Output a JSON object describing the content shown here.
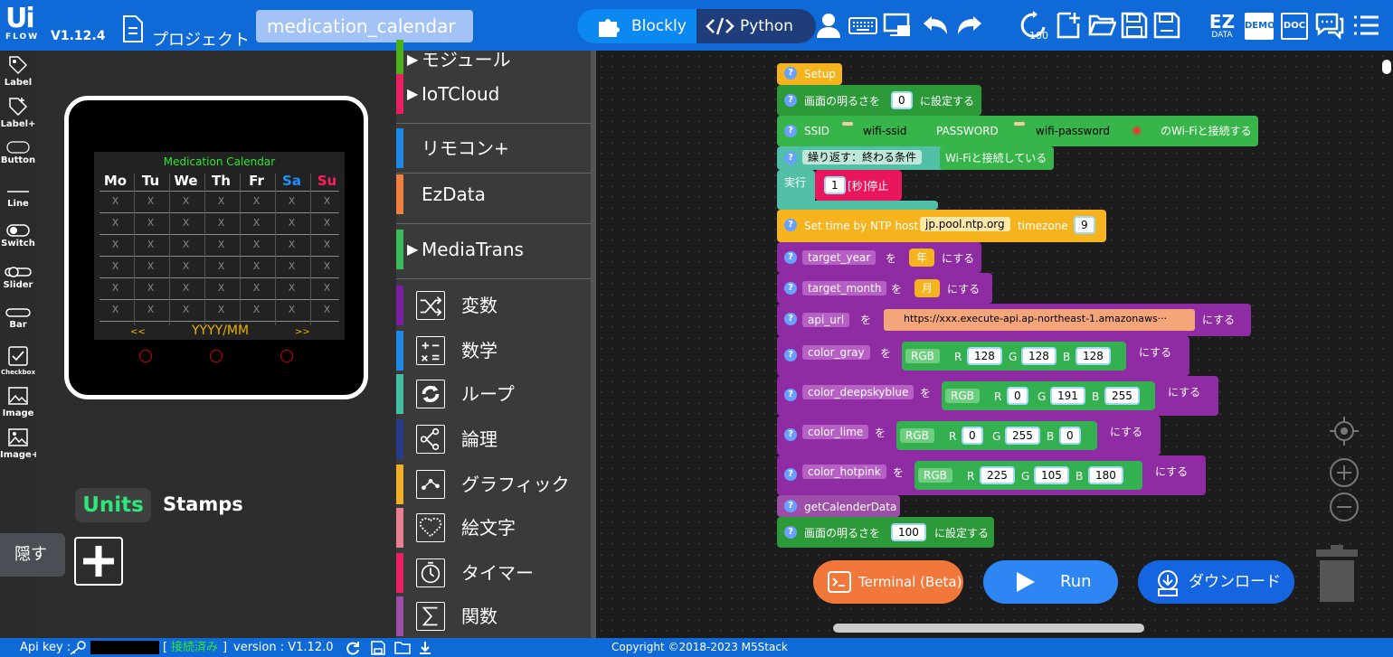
{
  "topbar": {
    "logo_top": "Ui",
    "logo_bottom": "FLOW",
    "version": "V1.12.4",
    "project_label": "プロジェクト",
    "project_name": "medication_calendar",
    "blockly_label": "Blockly",
    "python_label": "Python",
    "icons": [
      "user-icon",
      "keyboard-icon",
      "device-icon",
      "undo-icon",
      "redo-icon",
      "reset-100-icon",
      "new-file-icon",
      "open-folder-icon",
      "save-icon",
      "save-as-icon",
      "ezdata-icon",
      "demo-icon",
      "doc-icon",
      "chat-icon",
      "menu-icon"
    ],
    "ez_label": "EZ",
    "ez_sub": "DATA",
    "demo_label": "DEMO",
    "doc_label": "DOC"
  },
  "widgets": [
    "Label",
    "Label+",
    "Button",
    "Line",
    "Switch",
    "Slider",
    "Bar",
    "Checkbox",
    "Image",
    "Image+"
  ],
  "device": {
    "title": "Medication Calendar",
    "days": [
      "Mo",
      "Tu",
      "We",
      "Th",
      "Fr",
      "Sa",
      "Su"
    ],
    "day_colors": [
      "#ffffff",
      "#ffffff",
      "#ffffff",
      "#ffffff",
      "#ffffff",
      "#1e90ff",
      "#ff1f5a"
    ],
    "cell": "X",
    "rows": 6,
    "nav_prev": "<<",
    "nav_label": "YYYY/MM",
    "nav_next": ">>"
  },
  "units_tab": "Units",
  "stamps_tab": "Stamps",
  "hide_label": "隠す",
  "categories": [
    {
      "label": "モジュール",
      "color": "#4caf1c",
      "arrow": true,
      "icon": null
    },
    {
      "label": "IoTCloud",
      "color": "#e91e63",
      "arrow": true,
      "icon": null
    },
    {
      "label": "リモコン+",
      "color": "#1e88e5",
      "arrow": false,
      "icon": null
    },
    {
      "label": "EzData",
      "color": "#f08040",
      "arrow": false,
      "icon": null
    },
    {
      "label": "MediaTrans",
      "color": "#3cb95a",
      "arrow": true,
      "icon": null
    },
    {
      "label": "変数",
      "color": "#7b1fa2",
      "arrow": false,
      "icon": "shuffle-icon"
    },
    {
      "label": "数学",
      "color": "#1e88e5",
      "arrow": false,
      "icon": "math-icon"
    },
    {
      "label": "ループ",
      "color": "#40c0a0",
      "arrow": false,
      "icon": "loop-icon"
    },
    {
      "label": "論理",
      "color": "#283c8c",
      "arrow": false,
      "icon": "logic-icon"
    },
    {
      "label": "グラフィック",
      "color": "#f2b02a",
      "arrow": false,
      "icon": "graphic-icon"
    },
    {
      "label": "絵文字",
      "color": "#e88090",
      "arrow": false,
      "icon": "emoji-icon"
    },
    {
      "label": "タイマー",
      "color": "#e91e63",
      "arrow": false,
      "icon": "timer-icon"
    },
    {
      "label": "関数",
      "color": "#9c4ea8",
      "arrow": false,
      "icon": "function-icon"
    }
  ],
  "blocks": {
    "setup": "Setup",
    "brightness_pre": "画面の明るさを",
    "brightness_val1": "0",
    "brightness_post": "に設定する",
    "ssid_label": "SSID",
    "ssid_value": "wifi-ssid",
    "password_label": "PASSWORD",
    "password_value": "wifi-password",
    "wifi_connect": "のWi-Fiと接続する",
    "repeat_label": "繰り返す：終わる条件",
    "wifi_connected": "Wi-Fiと接続している",
    "do_label": "実行",
    "wait_value": "1",
    "wait_label": "[秒]停止",
    "ntp_label": "Set time by NTP host",
    "ntp_host": "jp.pool.ntp.org",
    "timezone_label": "timezone",
    "timezone_value": "9",
    "set_vars": [
      {
        "var": "target_year",
        "value": "年"
      },
      {
        "var": "target_month",
        "value": "月"
      }
    ],
    "api_var": "api_url",
    "api_value": "https://xxx.execute-api.ap-northeast-1.amazonaws···",
    "wo": "を",
    "nisuru": "にする",
    "colors": [
      {
        "var": "color_gray",
        "r": "128",
        "g": "128",
        "b": "128"
      },
      {
        "var": "color_deepskyblue",
        "r": "0",
        "g": "191",
        "b": "255"
      },
      {
        "var": "color_lime",
        "r": "0",
        "g": "255",
        "b": "0"
      },
      {
        "var": "color_hotpink",
        "r": "225",
        "g": "105",
        "b": "180"
      }
    ],
    "rgb_label": "RGB",
    "r_label": "R",
    "g_label": "G",
    "b_label": "B",
    "get_calendar": "getCalenderData",
    "brightness_val2": "100"
  },
  "buttons": {
    "terminal": "Terminal (Beta)",
    "run": "Run",
    "download": "ダウンロード"
  },
  "status": {
    "api_key_label": "Api key :",
    "connected": "接続済み",
    "version_label": "version : V1.12.0",
    "copyright": "Copyright ©2018-2023 M5Stack"
  }
}
